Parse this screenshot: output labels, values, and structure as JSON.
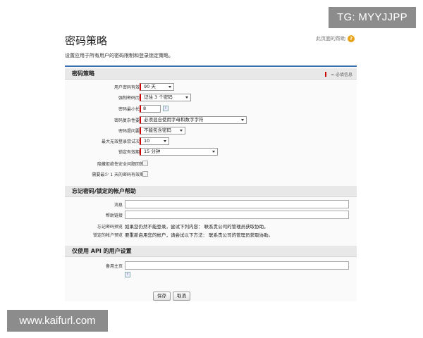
{
  "watermarks": {
    "top": "TG: MYYJJPP",
    "bottom": "www.kaifurl.com"
  },
  "page": {
    "title": "密码策略",
    "help_link": "此页面的帮助",
    "description": "设置应用于所有用户的密码限制和登录锁定策略。"
  },
  "required_note": "= 必填信息",
  "password_policy": {
    "title": "密码策略",
    "fields": [
      {
        "label": "用户密码有效期",
        "type": "select",
        "value": "90 天"
      },
      {
        "label": "强制密码历史",
        "type": "select",
        "value": "记住 3 个密码"
      },
      {
        "label": "密码最小长度",
        "type": "text",
        "value": "8"
      },
      {
        "label": "密码复杂性要求",
        "type": "select",
        "value": "必须混合使用字母和数字字符"
      },
      {
        "label": "密码提问要求",
        "type": "select",
        "value": "不能包含密码"
      },
      {
        "label": "最大无效登录尝试次数",
        "type": "select",
        "value": "10"
      },
      {
        "label": "锁定有效期间",
        "type": "select",
        "value": "15 分钟"
      },
      {
        "label": "隐藏拒绝性安全问题回答",
        "type": "checkbox",
        "value": ""
      },
      {
        "label": "需要最少 1 天的密码有效期",
        "type": "checkbox",
        "value": ""
      }
    ]
  },
  "forgot_password": {
    "title": "忘记密码/锁定的帐户帮助",
    "message_label": "消息",
    "help_link_label": "帮助链接",
    "forgot_preview_label": "忘记密码预览",
    "forgot_preview_text": "如果您仍然不能登录，尝试下列内容： 联系贵公司的管理员获取协助。",
    "locked_preview_label": "锁定的帐户预览",
    "locked_preview_text": "要重新启用您的帐户，请尝试以下方法： 联系贵公司的管理员获取协助。"
  },
  "api_only": {
    "title": "仅使用 API 的用户设置",
    "alt_home_label": "备用主页"
  },
  "buttons": {
    "save": "保存",
    "cancel": "取消"
  },
  "colors": {
    "accent": "#3a6fb0",
    "required": "#cc0000",
    "help_icon": "#e8a31a"
  }
}
